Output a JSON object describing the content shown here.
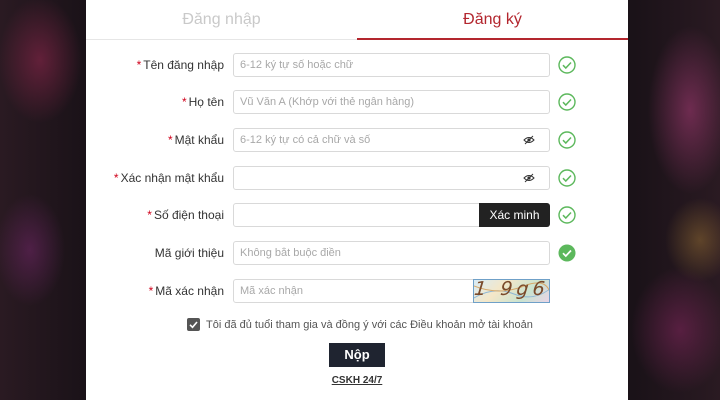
{
  "tabs": {
    "login": "Đăng nhập",
    "register": "Đăng ký"
  },
  "form": {
    "username": {
      "label": "Tên đăng nhập",
      "placeholder": "6-12 ký tự số hoặc chữ",
      "value": ""
    },
    "fullname": {
      "label": "Họ tên",
      "placeholder": "Vũ Văn A (Khớp với thẻ ngân hàng)",
      "value": ""
    },
    "password": {
      "label": "Mật khẩu",
      "placeholder": "6-12 ký tự có cả chữ và số",
      "value": ""
    },
    "confirm_password": {
      "label": "Xác nhận mật khẩu",
      "placeholder": "",
      "value": ""
    },
    "phone": {
      "label": "Số điện thoại",
      "placeholder": "",
      "value": "",
      "verify_label": "Xác minh"
    },
    "referral": {
      "label": "Mã giới thiệu",
      "placeholder": "Không bắt buộc điền",
      "value": ""
    },
    "captcha": {
      "label": "Mã xác nhận",
      "placeholder": "Mã xác nhận",
      "value": "",
      "image_text": "1 9g6"
    }
  },
  "agreement": {
    "text": "Tôi đã đủ tuổi tham gia và đồng ý với các Điều khoản mở tài khoản",
    "checked": true
  },
  "submit_label": "Nộp",
  "support_label": "CSKH 24/7",
  "colors": {
    "accent": "#b3262e",
    "check_green": "#5cb85c",
    "button_dark": "#1f2430"
  },
  "icons": {
    "valid": "check-circle-icon",
    "password_toggle": "eye-slash-icon"
  }
}
